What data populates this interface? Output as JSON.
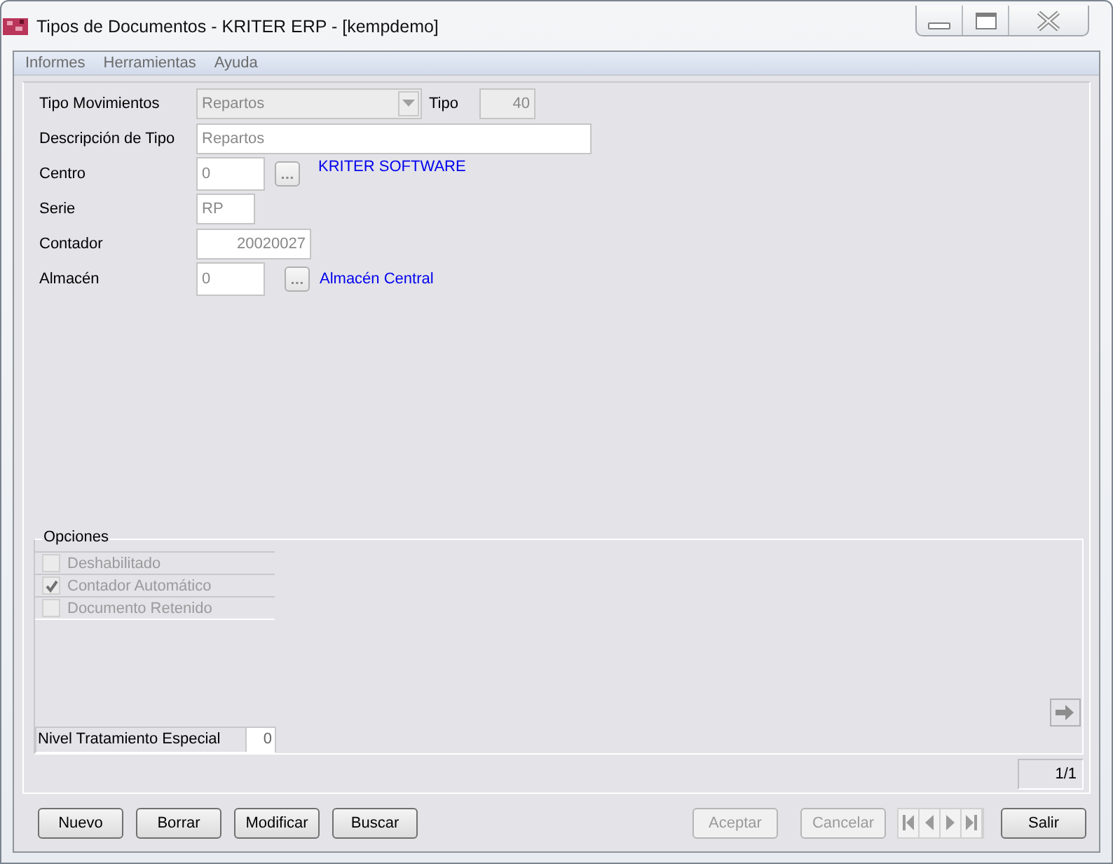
{
  "window": {
    "title": "Tipos de Documentos - KRITER ERP - [kempdemo]"
  },
  "menu": [
    {
      "label": "Informes"
    },
    {
      "label": "Herramientas"
    },
    {
      "label": "Ayuda"
    }
  ],
  "fields": [
    {
      "kind": "combo",
      "label": "Tipo Movimientos",
      "value": "Repartos",
      "extra_label": "Tipo",
      "extra_value": "40"
    },
    {
      "kind": "text",
      "label": "Descripción de Tipo",
      "value": "Repartos"
    },
    {
      "kind": "lookup",
      "label": "Centro",
      "value": "0",
      "link": "KRITER SOFTWARE"
    },
    {
      "kind": "short",
      "label": "Serie",
      "value": "RP"
    },
    {
      "kind": "number",
      "label": "Contador",
      "value": "20020027"
    },
    {
      "kind": "lookup",
      "label": "Almacén",
      "value": "0",
      "link": "Almacén Central"
    }
  ],
  "options": {
    "title": "Opciones",
    "items": [
      {
        "label": "Deshabilitado",
        "checked": false
      },
      {
        "label": "Contador Automático",
        "checked": true
      },
      {
        "label": "Documento Retenido",
        "checked": false
      }
    ],
    "level_label": "Nivel Tratamiento Especial",
    "level_value": "0"
  },
  "record_counter": "1/1",
  "buttons": [
    {
      "label": "Nuevo",
      "disabled": false
    },
    {
      "label": "Borrar",
      "disabled": false
    },
    {
      "label": "Modificar",
      "disabled": false
    },
    {
      "label": "Buscar",
      "disabled": false
    }
  ],
  "confirm_buttons": [
    {
      "label": "Aceptar",
      "disabled": true
    },
    {
      "label": "Cancelar",
      "disabled": true
    }
  ],
  "exit_button": {
    "label": "Salir",
    "disabled": false
  }
}
